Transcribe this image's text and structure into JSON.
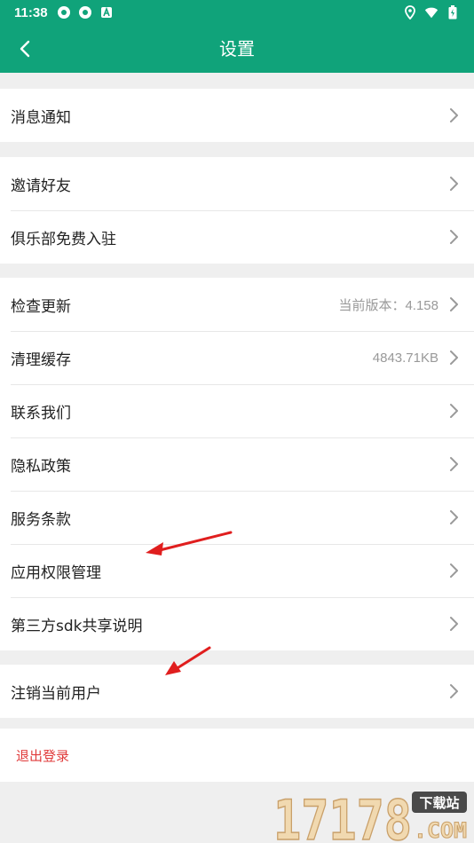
{
  "status_bar": {
    "time": "11:38"
  },
  "toolbar": {
    "title": "设置"
  },
  "groups": [
    {
      "items": [
        {
          "label": "消息通知",
          "value": ""
        }
      ]
    },
    {
      "items": [
        {
          "label": "邀请好友",
          "value": ""
        },
        {
          "label": "俱乐部免费入驻",
          "value": ""
        }
      ]
    },
    {
      "items": [
        {
          "label": "检查更新",
          "value": "当前版本：4.158"
        },
        {
          "label": "清理缓存",
          "value": "4843.71KB"
        },
        {
          "label": "联系我们",
          "value": ""
        },
        {
          "label": "隐私政策",
          "value": ""
        },
        {
          "label": "服务条款",
          "value": ""
        },
        {
          "label": "应用权限管理",
          "value": ""
        },
        {
          "label": "第三方sdk共享说明",
          "value": ""
        }
      ]
    },
    {
      "items": [
        {
          "label": "注销当前用户",
          "value": ""
        }
      ]
    }
  ],
  "logout": {
    "label": "退出登录"
  },
  "watermark": {
    "number": "17178",
    "tag": "下载站",
    "domain": ".COM"
  },
  "colors": {
    "primary": "#10a37a",
    "danger": "#e03b3b",
    "annotation": "#e01e1e"
  }
}
